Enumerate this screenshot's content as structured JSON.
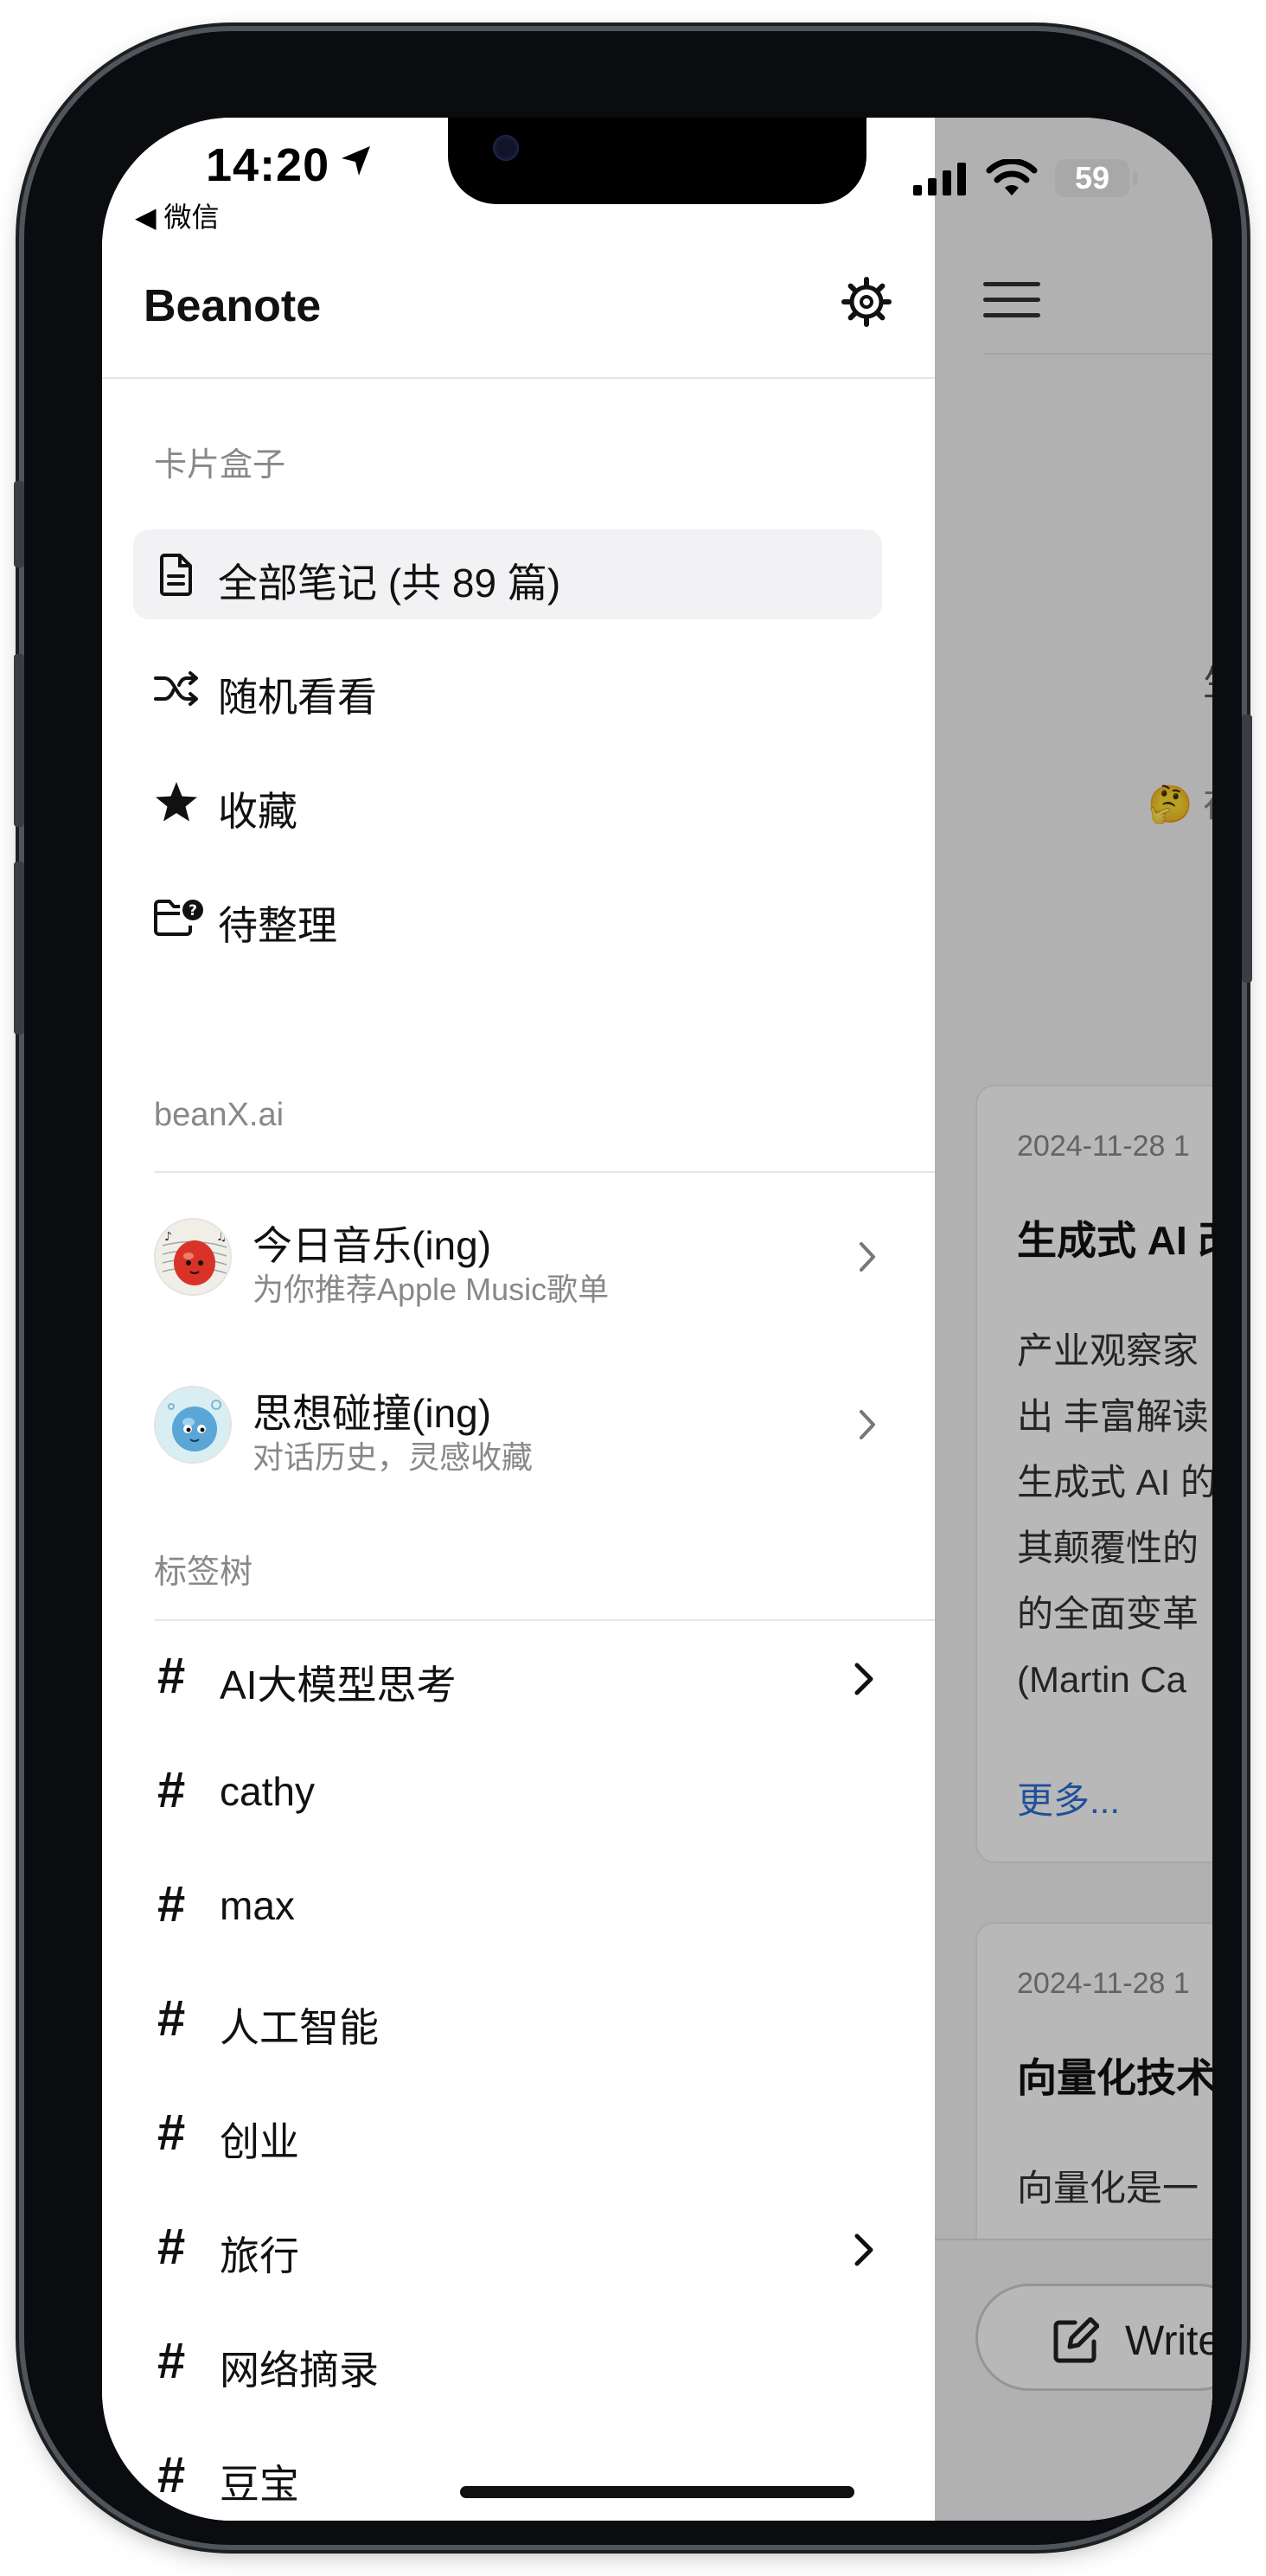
{
  "status_bar": {
    "time": "14:20",
    "back_label": "◀ 微信",
    "battery": "59"
  },
  "drawer": {
    "app_title": "Beanote",
    "sections": {
      "cards": "卡片盒子",
      "beanx": "beanX.ai",
      "tags": "标签树"
    },
    "nav_items": [
      {
        "label": "全部笔记 (共 89 篇)",
        "icon": "document-icon"
      },
      {
        "label": "随机看看",
        "icon": "shuffle-icon"
      },
      {
        "label": "收藏",
        "icon": "star-icon"
      },
      {
        "label": "待整理",
        "icon": "folder-question-icon"
      }
    ],
    "bean_items": [
      {
        "title": "今日音乐(ing)",
        "subtitle": "为你推荐Apple Music歌单"
      },
      {
        "title": "思想碰撞(ing)",
        "subtitle": "对话历史，灵感收藏"
      }
    ],
    "tags": [
      {
        "label": "AI大模型思考",
        "has_children": true
      },
      {
        "label": "cathy",
        "has_children": false
      },
      {
        "label": "max",
        "has_children": false
      },
      {
        "label": "人工智能",
        "has_children": false
      },
      {
        "label": "创业",
        "has_children": false
      },
      {
        "label": "旅行",
        "has_children": true
      },
      {
        "label": "网络摘录",
        "has_children": false
      },
      {
        "label": "豆宝",
        "has_children": false
      }
    ],
    "hash_symbol": "#"
  },
  "background": {
    "text1": "生成式",
    "text2": "🤔 在未",
    "cards": [
      {
        "date": "2024-11-28 1",
        "title": "生成式 AI 改",
        "body": [
          "产业观察家",
          "出 丰富解读",
          "生成式 AI 的",
          "其颠覆性的",
          "的全面变革",
          "(Martin Ca"
        ],
        "more": "更多..."
      },
      {
        "date": "2024-11-28 1",
        "title": "向量化技术",
        "body": [
          "向量化是一"
        ],
        "more": ""
      }
    ],
    "write_button": "Write"
  },
  "colors": {
    "accent_link": "#2d6fd6",
    "active_bg": "#f2f2f4",
    "muted_text": "#888888"
  }
}
